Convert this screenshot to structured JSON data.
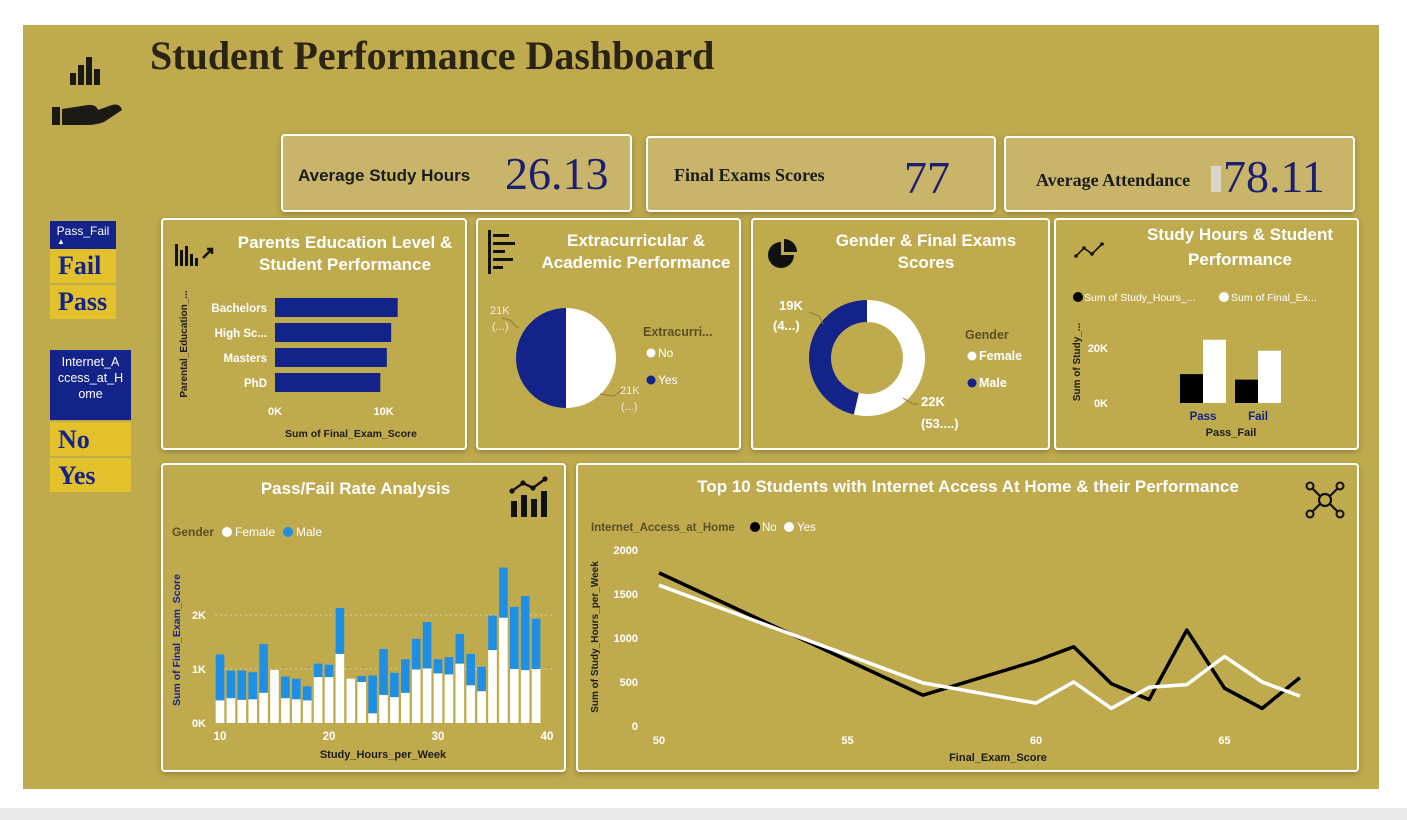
{
  "header": {
    "title": "Student Performance Dashboard",
    "logo_icon": "hand-with-bars-icon"
  },
  "kpis": [
    {
      "label": "Average Study Hours",
      "value": "26.13"
    },
    {
      "label": "Final Exams Scores",
      "value": "77"
    },
    {
      "label": "Average Attendance",
      "value": "78.11"
    }
  ],
  "slicers": {
    "pass_fail": {
      "title": "Pass_Fail",
      "items": [
        "Fail",
        "Pass"
      ]
    },
    "internet": {
      "title": "Internet_Access_at_Home",
      "title_lines": [
        "Internet_A",
        "ccess_at_H",
        "ome"
      ],
      "items": [
        "No",
        "Yes"
      ]
    }
  },
  "panels": {
    "parents": {
      "title_lines": [
        "Parents Education Level &",
        "Student Performance"
      ],
      "icon": "bar-chart-arrow-icon"
    },
    "extra": {
      "title_lines": [
        "Extracurricular &",
        "Academic Performance"
      ],
      "icon": "horizontal-bars-icon"
    },
    "gender": {
      "title_lines": [
        "Gender & Final Exams",
        "Scores"
      ],
      "icon": "pie-chart-icon"
    },
    "study": {
      "title_lines": [
        "Study Hours & Student",
        "Performance"
      ],
      "icon": "line-chart-icon"
    },
    "passfail": {
      "title": "Pass/Fail Rate Analysis",
      "icon": "bar-line-chart-icon"
    },
    "top10": {
      "title": "Top 10 Students with Internet Access At Home & their Performance",
      "icon": "network-icon"
    }
  },
  "colors": {
    "background": "#bfab4e",
    "navy": "#13238a",
    "blue": "#1f8fe6",
    "white": "#ffffff",
    "black": "#000000",
    "accent_yellow": "#e3c12c"
  },
  "chart_data": [
    {
      "id": "parents_education",
      "type": "bar",
      "orientation": "horizontal",
      "categories": [
        "Bachelors",
        "High Sc...",
        "Masters",
        "PhD"
      ],
      "values": [
        11300,
        10700,
        10300,
        9700
      ],
      "ylabel": "Parental_Education_...",
      "xlabel": "Sum of Final_Exam_Score",
      "xticks": [
        "0K",
        "10K"
      ],
      "xlim": [
        0,
        14000
      ]
    },
    {
      "id": "extracurricular",
      "type": "pie",
      "legend_title": "Extracurri...",
      "series": [
        {
          "name": "No",
          "value": 21000,
          "label": [
            "21K",
            "(...)"
          ]
        },
        {
          "name": "Yes",
          "value": 21000,
          "label": [
            "21K",
            "(...)"
          ]
        }
      ]
    },
    {
      "id": "gender",
      "type": "pie",
      "donut": true,
      "legend_title": "Gender",
      "series": [
        {
          "name": "Female",
          "value": 22000,
          "label": [
            "22K",
            "(53....)"
          ]
        },
        {
          "name": "Male",
          "value": 19000,
          "label": [
            "19K",
            "(4...)"
          ]
        }
      ]
    },
    {
      "id": "study_hours",
      "type": "bar",
      "categories": [
        "Pass",
        "Fail"
      ],
      "series": [
        {
          "name": "Sum of Study_Hours_...",
          "values": [
            10500,
            8500
          ]
        },
        {
          "name": "Sum of Final_Ex...",
          "values": [
            23000,
            19000
          ]
        }
      ],
      "xlabel": "Pass_Fail",
      "ylabel": "Sum of Study_...",
      "yticks": [
        "0K",
        "20K"
      ],
      "ylim": [
        0,
        28000
      ]
    },
    {
      "id": "pass_fail_rate",
      "type": "bar",
      "stacked": true,
      "legend_title": "Gender",
      "x": [
        10,
        11,
        12,
        13,
        14,
        15,
        16,
        17,
        18,
        19,
        20,
        21,
        22,
        23,
        24,
        25,
        26,
        27,
        28,
        29,
        30,
        31,
        32,
        33,
        34,
        35,
        36,
        37,
        38,
        39
      ],
      "series": [
        {
          "name": "Female",
          "values": [
            420,
            460,
            430,
            440,
            560,
            980,
            460,
            440,
            420,
            850,
            850,
            1280,
            820,
            760,
            180,
            520,
            480,
            560,
            990,
            1010,
            920,
            900,
            1100,
            700,
            590,
            1350,
            1950,
            1000,
            980,
            1000
          ]
        },
        {
          "name": "Male",
          "values": [
            850,
            510,
            540,
            500,
            900,
            0,
            400,
            380,
            260,
            250,
            230,
            850,
            0,
            110,
            700,
            850,
            450,
            620,
            570,
            860,
            260,
            320,
            550,
            580,
            450,
            640,
            930,
            1150,
            1370,
            930
          ]
        }
      ],
      "xlabel": "Study_Hours_per_Week",
      "ylabel": "Sum of Final_Exam_Score",
      "yticks": [
        "0K",
        "1K",
        "2K"
      ],
      "xticks": [
        "10",
        "20",
        "30",
        "40"
      ],
      "ylim": [
        0,
        3000
      ],
      "xlim": [
        9.5,
        40
      ]
    },
    {
      "id": "top10",
      "type": "line",
      "legend_title": "Internet_Access_at_Home",
      "series": [
        {
          "name": "No",
          "points": [
            [
              50,
              1740
            ],
            [
              57,
              350
            ],
            [
              60,
              740
            ],
            [
              61,
              900
            ],
            [
              62,
              480
            ],
            [
              63,
              300
            ],
            [
              64,
              1090
            ],
            [
              65,
              430
            ],
            [
              66,
              200
            ],
            [
              67,
              550
            ]
          ]
        },
        {
          "name": "Yes",
          "points": [
            [
              50,
              1600
            ],
            [
              57,
              490
            ],
            [
              60,
              260
            ],
            [
              61,
              500
            ],
            [
              62,
              200
            ],
            [
              63,
              440
            ],
            [
              64,
              470
            ],
            [
              65,
              790
            ],
            [
              66,
              500
            ],
            [
              67,
              340
            ]
          ]
        }
      ],
      "xlabel": "Final_Exam_Score",
      "ylabel": "Sum of Study_Hours_per_Week",
      "yticks": [
        "0",
        "500",
        "1000",
        "1500",
        "2000"
      ],
      "xticks": [
        "50",
        "55",
        "60",
        "65"
      ],
      "xlim": [
        50,
        68.5
      ],
      "ylim": [
        0,
        2000
      ]
    }
  ]
}
